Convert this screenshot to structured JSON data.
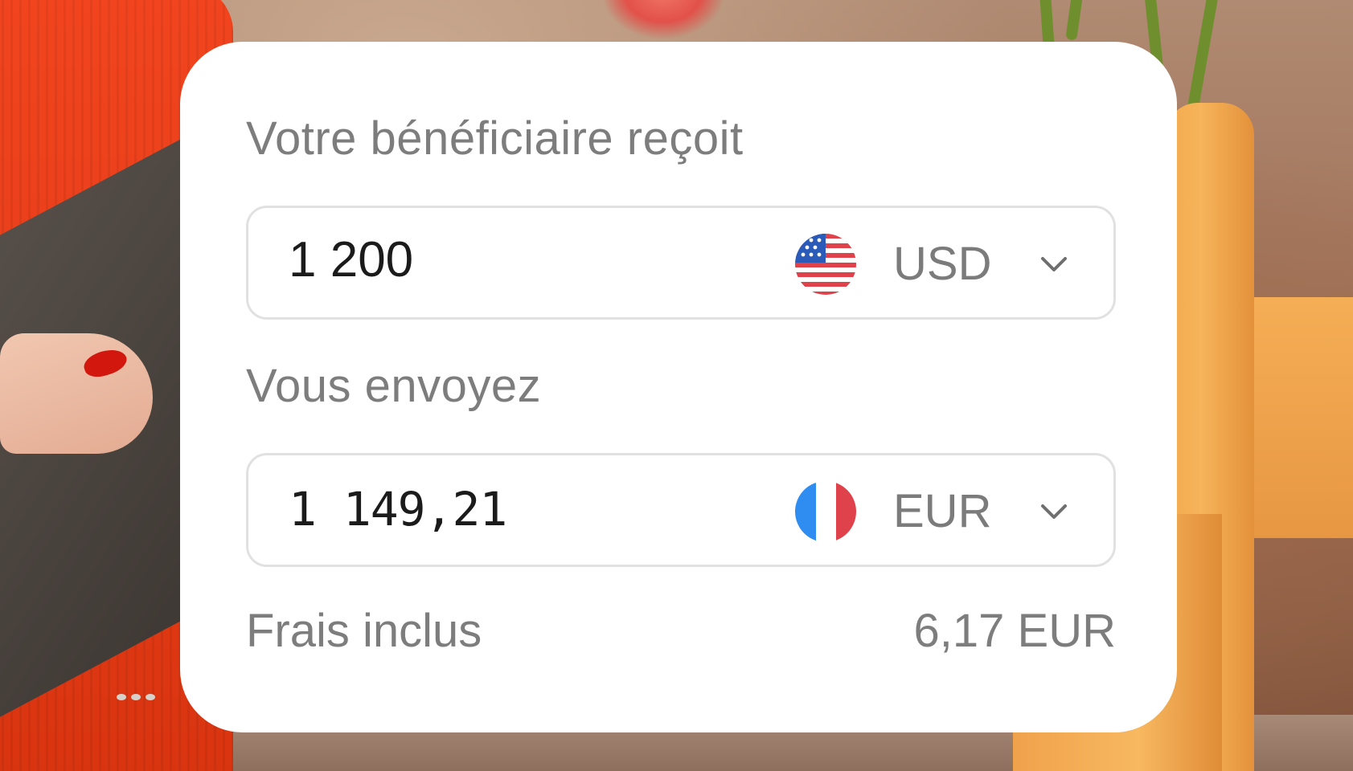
{
  "recipient_section": {
    "label": "Votre bénéficiaire reçoit",
    "amount": "1 200",
    "currency": "USD",
    "flag_icon": "us-flag-icon"
  },
  "sender_section": {
    "label": "Vous envoyez",
    "amount": "1 149,21",
    "currency": "EUR",
    "flag_icon": "france-flag-icon"
  },
  "fees": {
    "label": "Frais inclus",
    "value": "6,17 EUR"
  },
  "colors": {
    "card": "#ffffff",
    "label_text": "#7d7d7d",
    "amount_text": "#1b1b1b",
    "field_border": "#e1e1e1"
  }
}
